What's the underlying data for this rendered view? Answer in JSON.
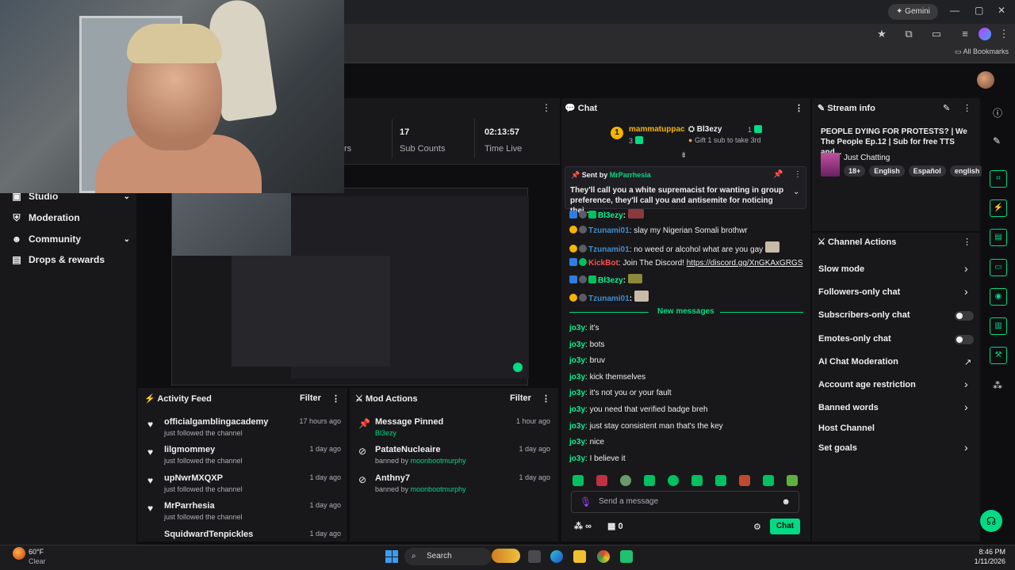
{
  "browser": {
    "gemini_label": "Gemini",
    "all_bookmarks": "All Bookmarks"
  },
  "nav": {
    "items": [
      {
        "label": "Studio",
        "icon": "studio-icon",
        "has_chevron": true
      },
      {
        "label": "Moderation",
        "icon": "shield-icon",
        "has_chevron": false
      },
      {
        "label": "Community",
        "icon": "community-icon",
        "has_chevron": true
      },
      {
        "label": "Drops & rewards",
        "icon": "gift-icon",
        "has_chevron": false
      }
    ]
  },
  "stats": {
    "partial_label": "rs",
    "sub_counts_value": "17",
    "sub_counts_label": "Sub Counts",
    "time_live_value": "02:13:57",
    "time_live_label": "Time Live"
  },
  "activity_feed": {
    "title": "Activity Feed",
    "filter": "Filter",
    "items": [
      {
        "name": "officialgamblingacademy",
        "sub": "just followed the channel",
        "time": "17 hours ago"
      },
      {
        "name": "lilgmommey",
        "sub": "just followed the channel",
        "time": "1 day ago"
      },
      {
        "name": "upNwrMXQXP",
        "sub": "just followed the channel",
        "time": "1 day ago"
      },
      {
        "name": "MrParrhesia",
        "sub": "just followed the channel",
        "time": "1 day ago"
      },
      {
        "name": "SquidwardTenpickles",
        "sub": "",
        "time": "1 day ago"
      }
    ]
  },
  "mod_actions": {
    "title": "Mod Actions",
    "filter": "Filter",
    "items": [
      {
        "title": "Message Pinned",
        "prefix": "",
        "actor": "Bl3ezy",
        "time": "1 hour ago"
      },
      {
        "title": "PatateNucleaire",
        "prefix": "banned by ",
        "actor": "moonbootmurphy",
        "time": "1 day ago"
      },
      {
        "title": "Anthny7",
        "prefix": "banned by ",
        "actor": "moonbootmurphy",
        "time": "1 day ago"
      }
    ]
  },
  "chat": {
    "title": "Chat",
    "leader_rank": "1",
    "leader_name": "mammatuppac",
    "leader_count": "3",
    "gifter_name": "Bl3ezy",
    "gifter_count": "1",
    "gift_text": "Gift 1 sub to take 3rd",
    "pinned_by_prefix": "Sent by ",
    "pinned_by": "MrParrhesia",
    "pinned_text": "They'll call you a white supremacist for wanting in group preference, they'll call you and antisemite for noticing thei...",
    "lines": [
      {
        "user": "Bl3ezy",
        "color": "green",
        "text": ""
      },
      {
        "user": "Tzunami01",
        "color": "blue",
        "text": ": slay my Nigerian Somali brothwr"
      },
      {
        "user": "Tzunami01",
        "color": "blue",
        "text": ": no weed or alcohol what are you gay"
      },
      {
        "user": "KickBot",
        "color": "red",
        "text": ": Join The Discord! ",
        "link": "https://discord.gg/XnGKAxGRGS"
      },
      {
        "user": "Bl3ezy",
        "color": "green",
        "text": ""
      },
      {
        "user": "Tzunami01",
        "color": "blue",
        "text": ""
      }
    ],
    "new_messages": "New messages",
    "messages": [
      {
        "user": "jo3y",
        "text": ": it's"
      },
      {
        "user": "jo3y",
        "text": ": bots"
      },
      {
        "user": "jo3y",
        "text": ": bruv"
      },
      {
        "user": "jo3y",
        "text": ": kick themselves"
      },
      {
        "user": "jo3y",
        "text": ": it's not you or your fault"
      },
      {
        "user": "jo3y",
        "text": ": you need that verified badge breh"
      },
      {
        "user": "jo3y",
        "text": ": just stay consistent man that's the key"
      },
      {
        "user": "jo3y",
        "text": ": nice"
      },
      {
        "user": "jo3y",
        "text": ": I believe it"
      }
    ],
    "input_placeholder": "Send a message",
    "points_symbol": "∞",
    "viewers": "0",
    "send_label": "Chat"
  },
  "stream_info": {
    "title": "Stream info",
    "stream_title": "PEOPLE DYING FOR PROTESTS? | We The People Ep.12 | Sub for free TTS and...",
    "category": "Just Chatting",
    "tags": [
      "18+",
      "English",
      "Español",
      "english"
    ]
  },
  "channel_actions": {
    "title": "Channel Actions",
    "items": [
      {
        "label": "Slow mode",
        "control": "chevron"
      },
      {
        "label": "Followers-only chat",
        "control": "chevron"
      },
      {
        "label": "Subscribers-only chat",
        "control": "toggle",
        "on": false
      },
      {
        "label": "Emotes-only chat",
        "control": "toggle",
        "on": false
      },
      {
        "label": "AI Chat Moderation",
        "control": "external"
      },
      {
        "label": "Account age restriction",
        "control": "chevron"
      },
      {
        "label": "Banned words",
        "control": "chevron"
      },
      {
        "label": "Host Channel",
        "control": "none"
      },
      {
        "label": "Set goals",
        "control": "chevron"
      }
    ]
  },
  "taskbar": {
    "weather_temp": "60°F",
    "weather_desc": "Clear",
    "search_label": "Search",
    "time": "8:46 PM",
    "date": "1/11/2026"
  },
  "colors": {
    "accent": "#00db84",
    "panel": "#18181b",
    "background": "#0e0e10"
  }
}
